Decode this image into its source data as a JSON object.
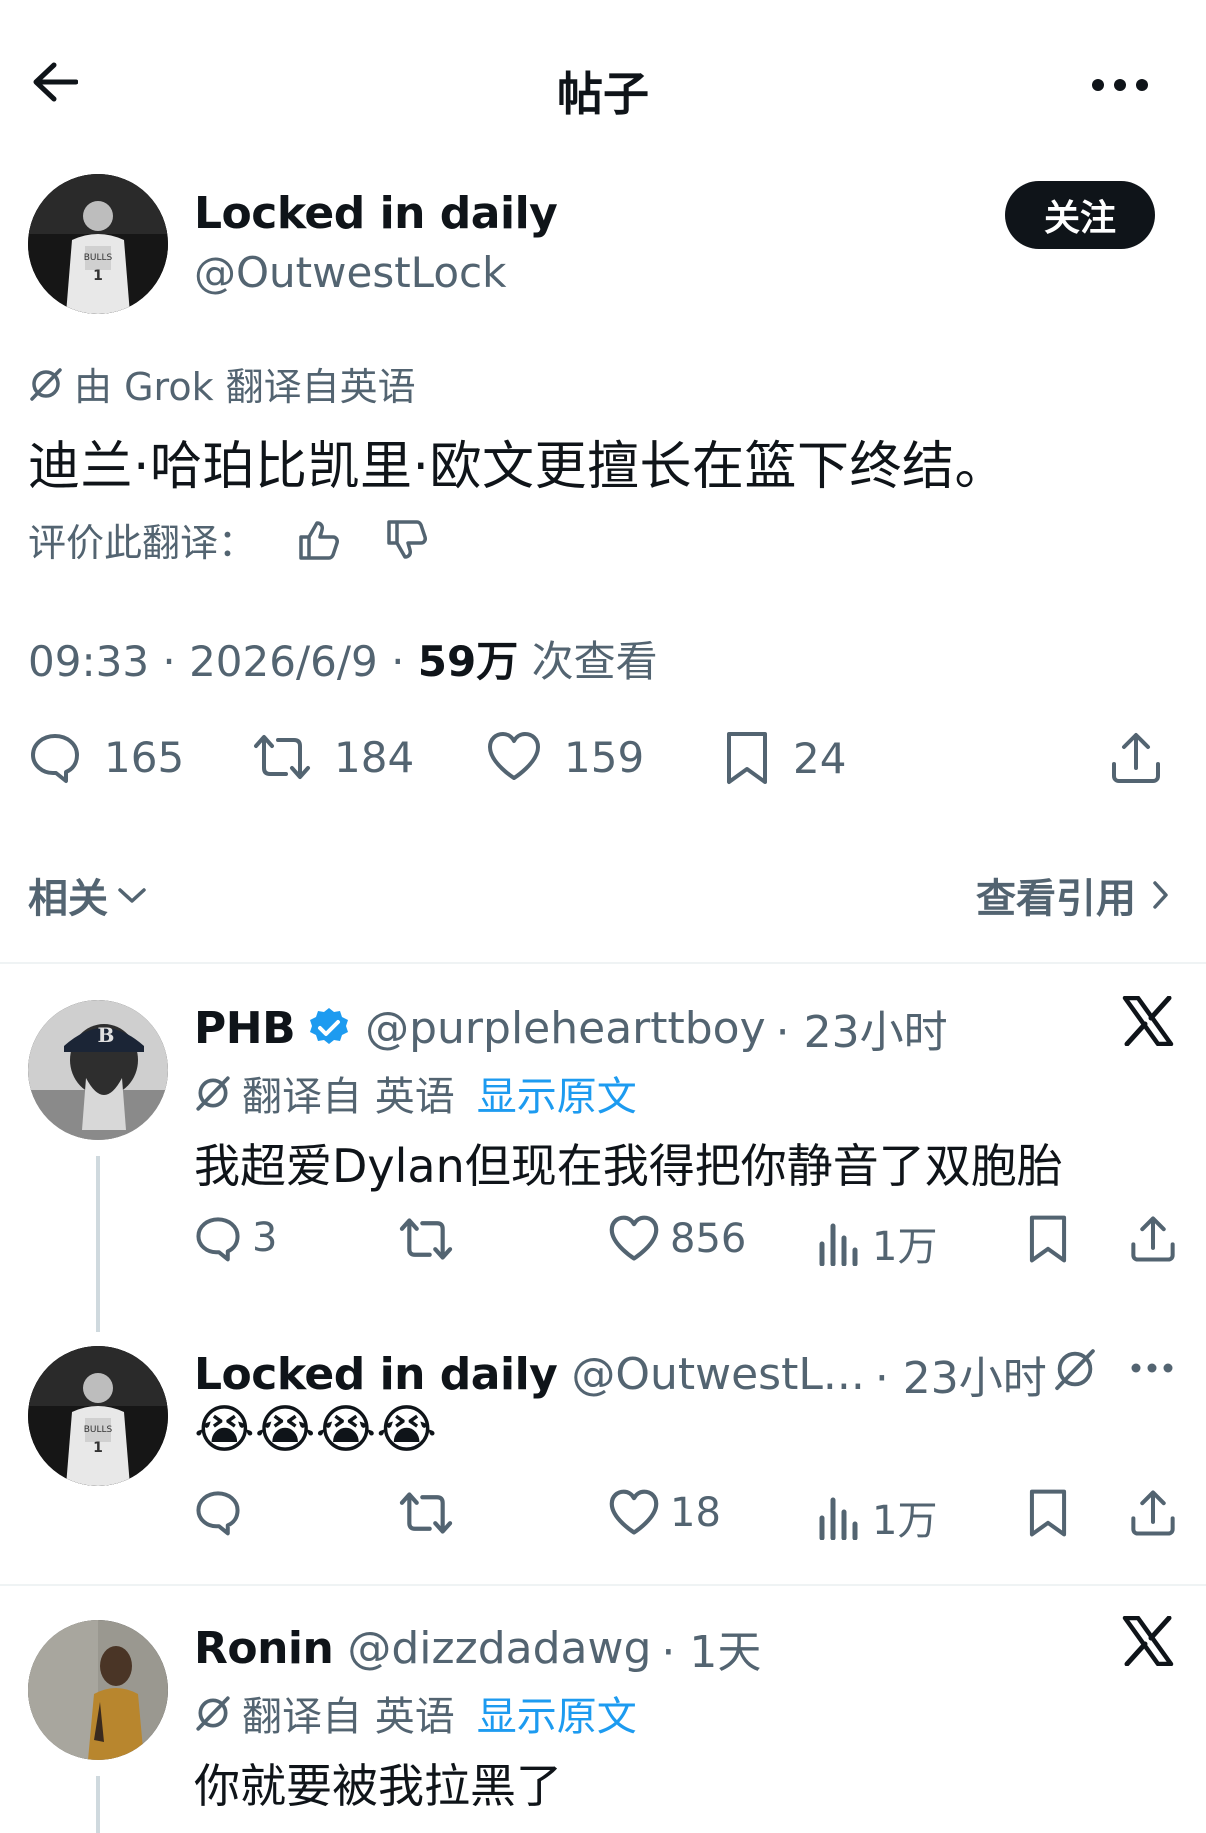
{
  "header": {
    "title": "帖子"
  },
  "post": {
    "author_name": "Locked in daily",
    "author_handle": "@OutwestLock",
    "follow_label": "关注",
    "translation_note": "由 Grok 翻译自英语",
    "text": "迪兰·哈珀比凯里·欧文更擅长在篮下终结。",
    "rate_label": "评价此翻译：",
    "time": "09:33 · 2026/6/9 · ",
    "views": "59万",
    "views_label": " 次查看",
    "stats": {
      "replies": "165",
      "reposts": "184",
      "likes": "159",
      "bookmarks": "24"
    },
    "related_label": "相关",
    "quotes_label": "查看引用"
  },
  "replies": [
    {
      "name": "PHB",
      "handle": "@purplehearttboy",
      "time": "· 23小时",
      "translated_label": "翻译自 英语",
      "show_original": "显示原文",
      "text": "我超爱Dylan但现在我得把你静音了双胞胎",
      "replies": "3",
      "reposts": "",
      "likes": "856",
      "views": "1万"
    },
    {
      "name": "Locked in daily",
      "handle": "@OutwestL...",
      "time": "· 23小时",
      "text": "😭😭😭😭",
      "replies": "",
      "reposts": "",
      "likes": "18",
      "views": "1万"
    },
    {
      "name": "Ronin",
      "handle": "@dizzdadawg",
      "time": "· 1天",
      "translated_label": "翻译自 英语",
      "show_original": "显示原文",
      "text": "你就要被我拉黑了"
    }
  ],
  "colors": {
    "text": "#0f1419",
    "muted": "#536471",
    "link": "#1d9bf0",
    "verified": "#1d9bf0",
    "divider": "#eff3f4"
  }
}
